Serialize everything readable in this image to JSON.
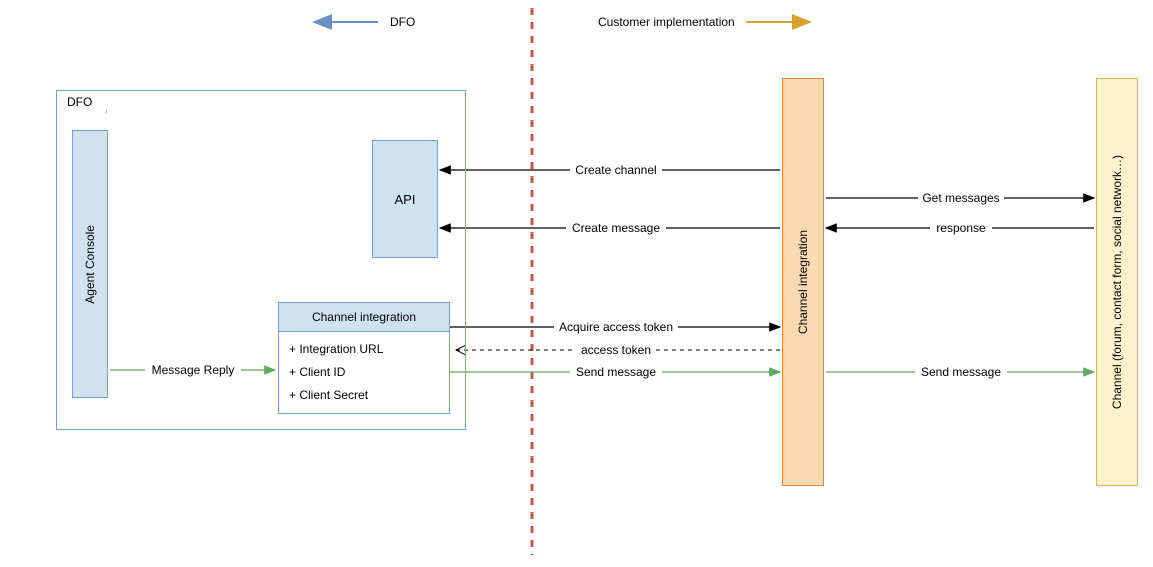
{
  "header": {
    "left": "DFO",
    "right": "Customer implementation"
  },
  "dfo": {
    "frame_label": "DFO",
    "agent_console": "Agent Console",
    "api": "API",
    "channel_integration": {
      "title": "Channel integration",
      "items": [
        "+ Integration URL",
        "+ Client ID",
        "+ Client Secret"
      ]
    }
  },
  "right": {
    "channel_integration": "Channel integration",
    "channel": "Channel (forum, contact form, social network…)"
  },
  "arrows": {
    "message_reply": "Message Reply",
    "create_channel": "Create channel",
    "create_message": "Create message",
    "acquire_token": "Acquire access token",
    "access_token": "access token",
    "send_message_1": "Send message",
    "get_messages": "Get messages",
    "response": "response",
    "send_message_2": "Send message"
  }
}
